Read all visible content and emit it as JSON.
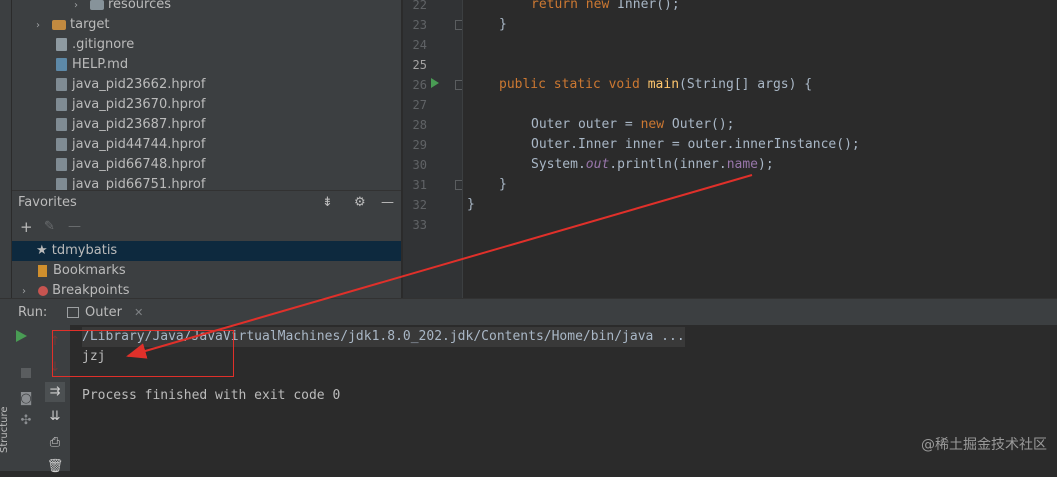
{
  "project_tree": [
    {
      "label": "resources",
      "type": "folder",
      "indent": 3,
      "chevron": "›",
      "color": "#87939a"
    },
    {
      "label": "target",
      "type": "folder",
      "indent": 1,
      "chevron": "›",
      "color": "#c28a40"
    },
    {
      "label": ".gitignore",
      "type": "file",
      "icon": "git"
    },
    {
      "label": "HELP.md",
      "type": "file",
      "icon": "md"
    },
    {
      "label": "java_pid23662.hprof",
      "type": "file",
      "icon": "hprof"
    },
    {
      "label": "java_pid23670.hprof",
      "type": "file",
      "icon": "hprof"
    },
    {
      "label": "java_pid23687.hprof",
      "type": "file",
      "icon": "hprof"
    },
    {
      "label": "java_pid44744.hprof",
      "type": "file",
      "icon": "hprof"
    },
    {
      "label": "java_pid66748.hprof",
      "type": "file",
      "icon": "hprof"
    },
    {
      "label": "java_pid66751.hprof",
      "type": "file",
      "icon": "hprof"
    }
  ],
  "favorites": {
    "title": "Favorites",
    "items": [
      {
        "label": "tdmybatis",
        "icon": "star-icon",
        "selected": true
      },
      {
        "label": "Bookmarks",
        "icon": "bookmark-icon",
        "selected": false
      },
      {
        "label": "Breakpoints",
        "icon": "breakpoint-icon",
        "selected": false
      }
    ]
  },
  "editor": {
    "line_numbers": [
      "22",
      "23",
      "24",
      "25",
      "26",
      "27",
      "28",
      "29",
      "30",
      "31",
      "32",
      "33"
    ],
    "current_line": "25"
  },
  "run": {
    "label": "Run:",
    "tab": "Outer",
    "console_lines": [
      "/Library/Java/JavaVirtualMachines/jdk1.8.0_202.jdk/Contents/Home/bin/java ...",
      "jzj",
      "",
      "Process finished with exit code 0"
    ]
  },
  "side_tool": "Structure",
  "watermark": "@稀土掘金技术社区",
  "colors": {
    "annotation": "#e0302a",
    "accent_run": "#499c54"
  }
}
